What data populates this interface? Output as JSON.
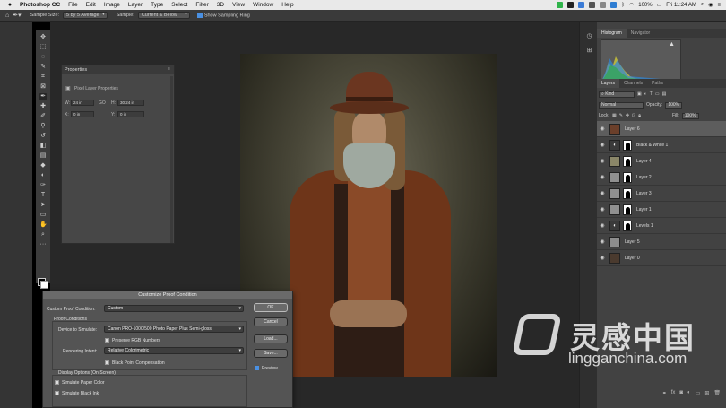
{
  "menubar": {
    "app": "Photoshop CC",
    "items": [
      "File",
      "Edit",
      "Image",
      "Layer",
      "Type",
      "Select",
      "Filter",
      "3D",
      "View",
      "Window",
      "Help"
    ],
    "battery": "100%",
    "clock": "Fri 11:24 AM"
  },
  "options": {
    "sample_size_label": "Sample Size:",
    "sample_size_value": "5 by 5 Average",
    "sample_label": "Sample:",
    "sample_value": "Current & Below",
    "show_ring": "Show Sampling Ring"
  },
  "properties": {
    "tab": "Properties",
    "type": "Pixel Layer Properties",
    "w_label": "W:",
    "w_value": "24 in",
    "go_label": "GO",
    "h_label": "H:",
    "h_value": "30.24 in",
    "x_label": "X:",
    "x_value": "0 in",
    "y_label": "Y:",
    "y_value": "0 in"
  },
  "panels": {
    "histogram_tab": "Histogram",
    "navigator_tab": "Navigator",
    "layers_tab": "Layers",
    "channels_tab": "Channels",
    "paths_tab": "Paths",
    "kind": "Kind",
    "blend_mode": "Normal",
    "opacity_label": "Opacity:",
    "opacity_value": "100%",
    "lock_label": "Lock:",
    "fill_label": "Fill:",
    "fill_value": "100%"
  },
  "layers": [
    {
      "name": "Layer 6",
      "selected": true
    },
    {
      "name": "Black & White 1",
      "selected": false
    },
    {
      "name": "Layer 4",
      "selected": false
    },
    {
      "name": "Layer 2",
      "selected": false
    },
    {
      "name": "Layer 3",
      "selected": false
    },
    {
      "name": "Layer 1",
      "selected": false
    },
    {
      "name": "Levels 1",
      "selected": false
    },
    {
      "name": "Layer 5",
      "selected": false
    },
    {
      "name": "Layer 0",
      "selected": false
    }
  ],
  "dialog": {
    "title": "Customize Proof Condition",
    "condition_label": "Custom Proof Condition:",
    "condition_value": "Custom",
    "proof_conditions": "Proof Conditions",
    "device_label": "Device to Simulate:",
    "device_value": "Canon PRO-1000/500 Photo Paper Plus Semi-gloss",
    "preserve_rgb": "Preserve RGB Numbers",
    "intent_label": "Rendering Intent:",
    "intent_value": "Relative Colorimetric",
    "bpc": "Black Point Compensation",
    "display_options": "Display Options (On-Screen)",
    "sim_paper": "Simulate Paper Color",
    "sim_ink": "Simulate Black Ink",
    "ok": "OK",
    "cancel": "Cancel",
    "load": "Load...",
    "save": "Save...",
    "preview": "Preview"
  },
  "watermark": {
    "cn": "灵感中国",
    "url": "lingganchina.com"
  },
  "colors": {
    "accent": "#4a90e2",
    "panel": "#424242",
    "canvas": "#282828"
  }
}
